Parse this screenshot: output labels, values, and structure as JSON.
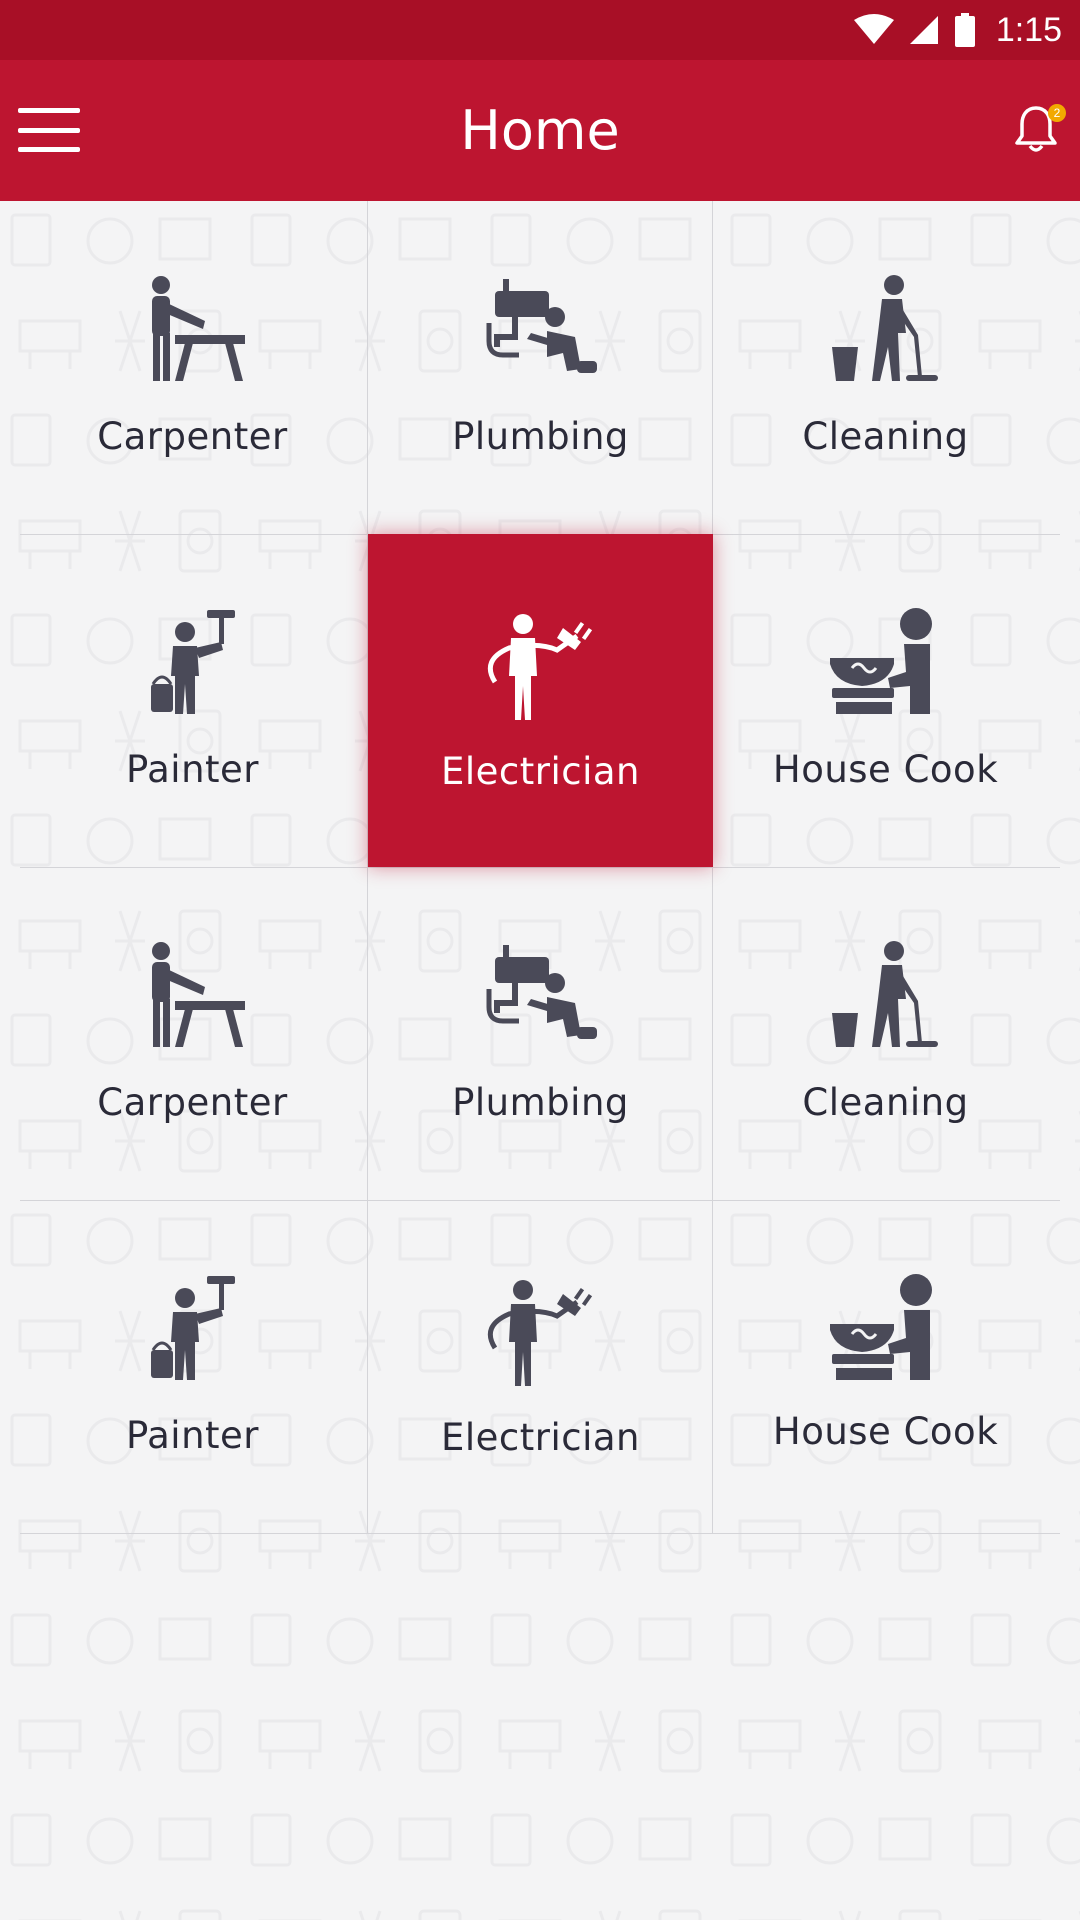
{
  "status_bar": {
    "time": "1:15",
    "icons": [
      "wifi-icon",
      "signal-icon",
      "battery-icon"
    ]
  },
  "app_bar": {
    "title": "Home",
    "menu_icon": "hamburger-menu-icon",
    "notification_icon": "bell-icon",
    "notification_count": "2"
  },
  "colors": {
    "primary": "#bd1530",
    "status_bar": "#a80f26",
    "icon": "#4a4a58",
    "badge": "#f2a900"
  },
  "services": [
    {
      "label": "Carpenter",
      "icon": "carpenter-icon"
    },
    {
      "label": "Plumbing",
      "icon": "plumbing-icon"
    },
    {
      "label": "Cleaning",
      "icon": "cleaning-icon"
    },
    {
      "label": "Painter",
      "icon": "painter-icon"
    },
    {
      "label": "Electrician",
      "icon": "electrician-icon",
      "selected": true
    },
    {
      "label": "House Cook",
      "icon": "house-cook-icon"
    },
    {
      "label": "Carpenter",
      "icon": "carpenter-icon"
    },
    {
      "label": "Plumbing",
      "icon": "plumbing-icon"
    },
    {
      "label": "Cleaning",
      "icon": "cleaning-icon"
    },
    {
      "label": "Painter",
      "icon": "painter-icon"
    },
    {
      "label": "Electrician",
      "icon": "electrician-icon"
    },
    {
      "label": "House Cook",
      "icon": "house-cook-icon"
    }
  ]
}
